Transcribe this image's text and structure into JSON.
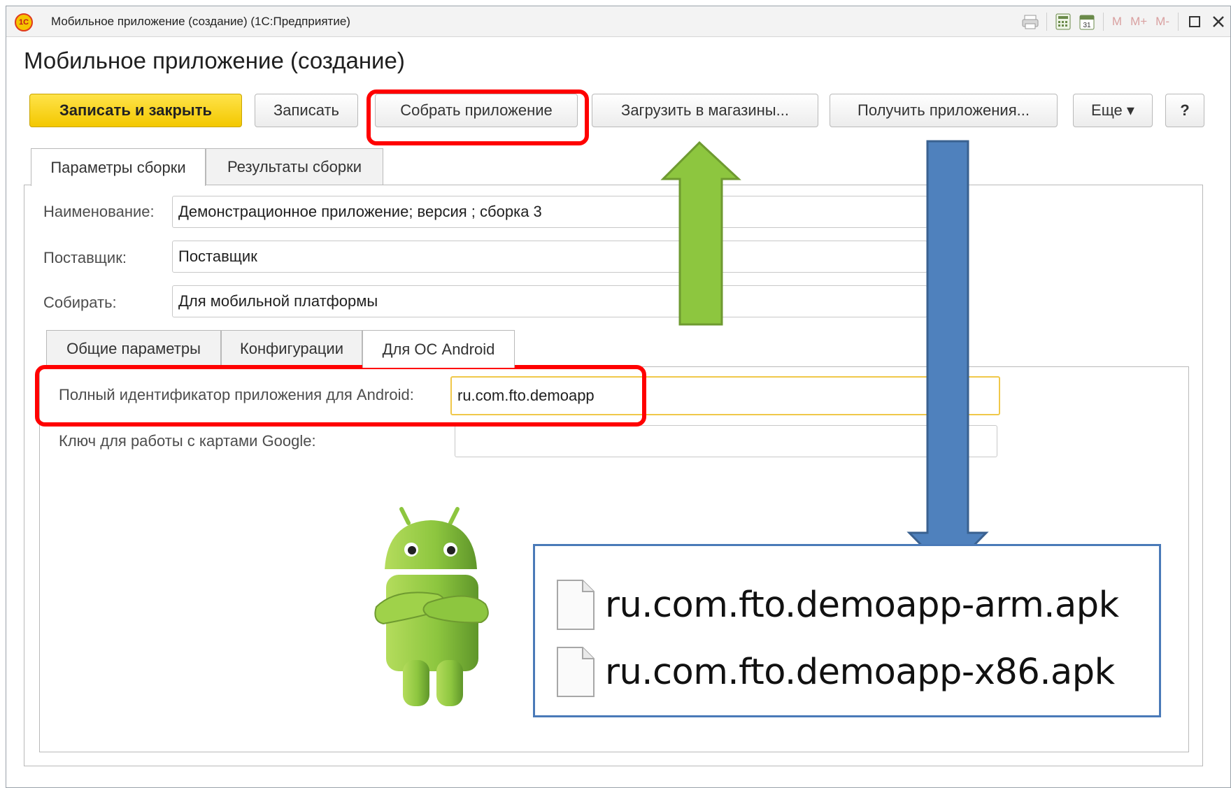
{
  "window": {
    "title": "Мобильное приложение (создание)  (1С:Предприятие)",
    "logo_text": "1С",
    "titlebar_buttons": [
      "print-icon",
      "calculator-icon",
      "calendar-icon",
      "M",
      "M+",
      "M-",
      "maximize-icon",
      "close-icon"
    ]
  },
  "form": {
    "title": "Мобильное приложение (создание)"
  },
  "toolbar": {
    "save_close": "Записать и закрыть",
    "save": "Записать",
    "build": "Собрать приложение",
    "upload": "Загрузить в магазины...",
    "get_apps": "Получить приложения...",
    "more": "Еще ▾",
    "help": "?"
  },
  "tabs": [
    {
      "label": "Параметры сборки",
      "active": true
    },
    {
      "label": "Результаты сборки",
      "active": false
    }
  ],
  "fields": {
    "name_label": "Наименование:",
    "name_value": "Демонстрационное приложение; версия ; сборка 3",
    "vendor_label": "Поставщик:",
    "vendor_value": "Поставщик",
    "build_for_label": "Собирать:",
    "build_for_value": "Для мобильной платформы"
  },
  "subtabs": [
    {
      "label": "Общие параметры",
      "active": false
    },
    {
      "label": "Конфигурации",
      "active": false
    },
    {
      "label": "Для ОС Android",
      "active": true
    }
  ],
  "android": {
    "app_id_label": "Полный идентификатор приложения для Android:",
    "app_id_value": "ru.com.fto.demoapp",
    "maps_key_label": "Ключ для работы с картами Google:",
    "maps_key_value": ""
  },
  "output_files": [
    "ru.com.fto.demoapp-arm.apk",
    "ru.com.fto.demoapp-x86.apk"
  ],
  "colors": {
    "highlight_frame": "#ff0000",
    "green_arrow": "#8dc63f",
    "blue_arrow": "#4f81bd",
    "primary_button": "#f3c800",
    "focused_field": "#f0c84a",
    "android_green": "#8dc63f"
  }
}
